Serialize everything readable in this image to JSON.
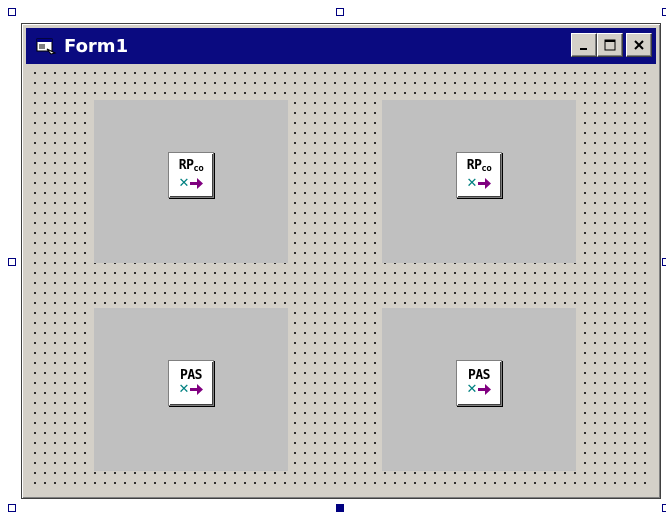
{
  "form": {
    "title": "Form1",
    "title_bar_color": "#0a0a80",
    "caption_buttons": [
      "minimize",
      "maximize",
      "close"
    ]
  },
  "controls": [
    {
      "label": "RPᶜᵒ",
      "main": "RP",
      "sub": "co",
      "icon": "rpco-component-icon"
    },
    {
      "label": "RPᶜᵒ",
      "main": "RP",
      "sub": "co",
      "icon": "rpco-component-icon"
    },
    {
      "label": "PAS",
      "main": "PAS",
      "sub": "",
      "icon": "pas-component-icon"
    },
    {
      "label": "PAS",
      "main": "PAS",
      "sub": "",
      "icon": "pas-component-icon"
    }
  ],
  "colors": {
    "form_background": "#d4d0c8",
    "panel_background": "#c0c0c0",
    "x_glyph": "#008080",
    "arrow_glyph": "#800080"
  }
}
